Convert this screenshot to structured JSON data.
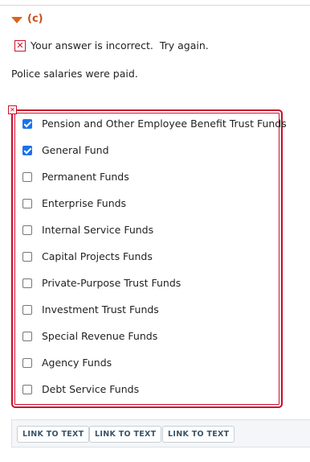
{
  "part": {
    "label": "(c)"
  },
  "feedback": {
    "message": "Your answer is incorrect.  Try again."
  },
  "question": {
    "text": "Police salaries were paid."
  },
  "options": [
    {
      "label": "Pension and Other Employee Benefit Trust Funds",
      "checked": true
    },
    {
      "label": "General Fund",
      "checked": true
    },
    {
      "label": "Permanent Funds",
      "checked": false
    },
    {
      "label": "Enterprise Funds",
      "checked": false
    },
    {
      "label": "Internal Service Funds",
      "checked": false
    },
    {
      "label": "Capital Projects Funds",
      "checked": false
    },
    {
      "label": "Private-Purpose Trust Funds",
      "checked": false
    },
    {
      "label": "Investment Trust Funds",
      "checked": false
    },
    {
      "label": "Special Revenue Funds",
      "checked": false
    },
    {
      "label": "Agency Funds",
      "checked": false
    },
    {
      "label": "Debt Service Funds",
      "checked": false
    }
  ],
  "links": [
    {
      "label": "LINK TO TEXT"
    },
    {
      "label": "LINK TO TEXT"
    },
    {
      "label": "LINK TO TEXT"
    }
  ],
  "colors": {
    "accent": "#e0621b",
    "error": "#c8102e",
    "checkbox_checked": "#1a73e8"
  }
}
